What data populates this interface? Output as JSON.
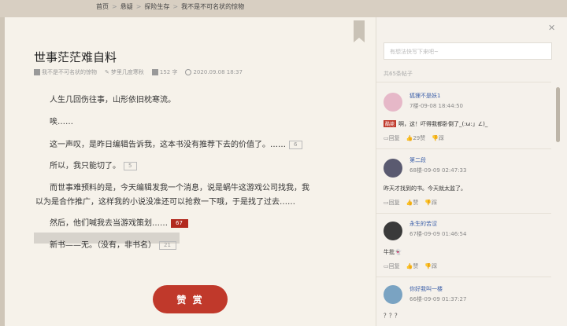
{
  "breadcrumb": [
    "首页",
    "悬疑",
    "探险生存",
    "我不是不可名状的惊物"
  ],
  "chapter": {
    "title": "世事茫茫难自料",
    "book": "我不是不可名状的惊物",
    "author": "梦里几度寒秋",
    "word_count": "152 字",
    "date": "2020.09.08 18:37"
  },
  "paragraphs": [
    {
      "text": "人生几回伤往事，山形依旧枕寒流。",
      "comments": ""
    },
    {
      "text": "唉……",
      "comments": ""
    },
    {
      "text": "这一声叹，是昨日编辑告诉我，这本书没有推荐下去的价值了。……",
      "comments": "6"
    },
    {
      "text": "所以，我只能切了。",
      "comments": "5"
    },
    {
      "text": "而世事难预料的是，今天编辑发我一个消息，说是蜗牛这游戏公司找我，我",
      "comments": ""
    },
    {
      "text": "以为是合作推广，这样我的小说没准还可以抢救一下哦，于是找了过去……",
      "comments": ""
    },
    {
      "text": "然后，他们喊我去当游戏策划……",
      "comments": "67"
    },
    {
      "text": "新书——无。（没有，非书名）",
      "comments": "21"
    }
  ],
  "tip_button": "赞 赏",
  "sidebar": {
    "input_placeholder": "有想法快写下来吧~",
    "total": "共65条帖子",
    "comments": [
      {
        "name": "狐狸不是妖1",
        "time": "7楼-09-08 18:44:50",
        "badge": "酷毙",
        "text": "啊，这！吓得我都卧倒了_(:ω:」∠)_",
        "reply": "回复",
        "likes": "29赞",
        "dislike": "踩"
      },
      {
        "name": "第二段",
        "time": "68楼-09-09 02:47:33",
        "badge": "",
        "text": "昨天才找到的书。今天就太监了。",
        "reply": "回复",
        "likes": "赞",
        "dislike": "踩"
      },
      {
        "name": "永生的苦涩",
        "time": "67楼-09-09 01:46:54",
        "badge": "",
        "text": "牛批👻",
        "reply": "回复",
        "likes": "赞",
        "dislike": "踩"
      },
      {
        "name": "你好我叫一楼",
        "time": "66楼-09-09 01:37:27",
        "badge": "",
        "text": "？？？",
        "reply": "",
        "likes": "",
        "dislike": ""
      }
    ]
  },
  "colors": {
    "accent": "#c0392b",
    "link": "#3a5ea8",
    "page_bg": "#f6f2ea"
  }
}
